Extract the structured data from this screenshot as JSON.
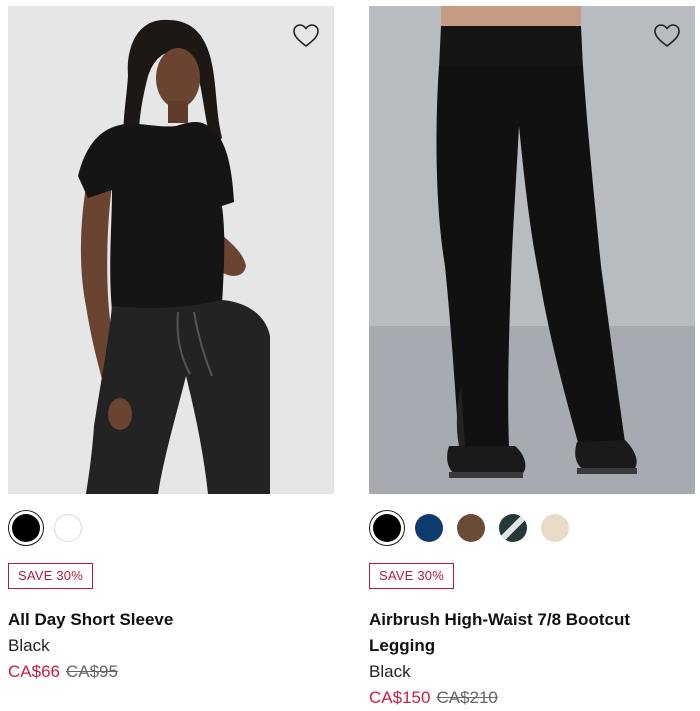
{
  "products": [
    {
      "name": "All Day Short Sleeve",
      "color": "Black",
      "badge": "SAVE 30%",
      "price_sale": "CA$66",
      "price_original": "CA$95",
      "wishlist_icon": "heart-outline-icon",
      "swatches": [
        {
          "name": "black",
          "color": "#000000",
          "selected": true
        },
        {
          "name": "white",
          "color": "#ffffff",
          "selected": false
        }
      ]
    },
    {
      "name": "Airbrush High-Waist 7/8 Bootcut Legging",
      "color": "Black",
      "badge": "SAVE 30%",
      "price_sale": "CA$150",
      "price_original": "CA$210",
      "wishlist_icon": "heart-outline-icon",
      "swatches": [
        {
          "name": "black",
          "color": "#000000",
          "selected": true
        },
        {
          "name": "navy",
          "color": "#0e3a6e",
          "selected": false
        },
        {
          "name": "brown",
          "color": "#6b4a36",
          "selected": false
        },
        {
          "name": "dark-green-stripe",
          "color": "#27383a",
          "selected": false
        },
        {
          "name": "cream",
          "color": "#e8dcc7",
          "selected": false
        }
      ]
    }
  ],
  "colors": {
    "sale_red": "#c8213f",
    "badge_red": "#b8193a",
    "text": "#111111",
    "strike": "#666666"
  }
}
